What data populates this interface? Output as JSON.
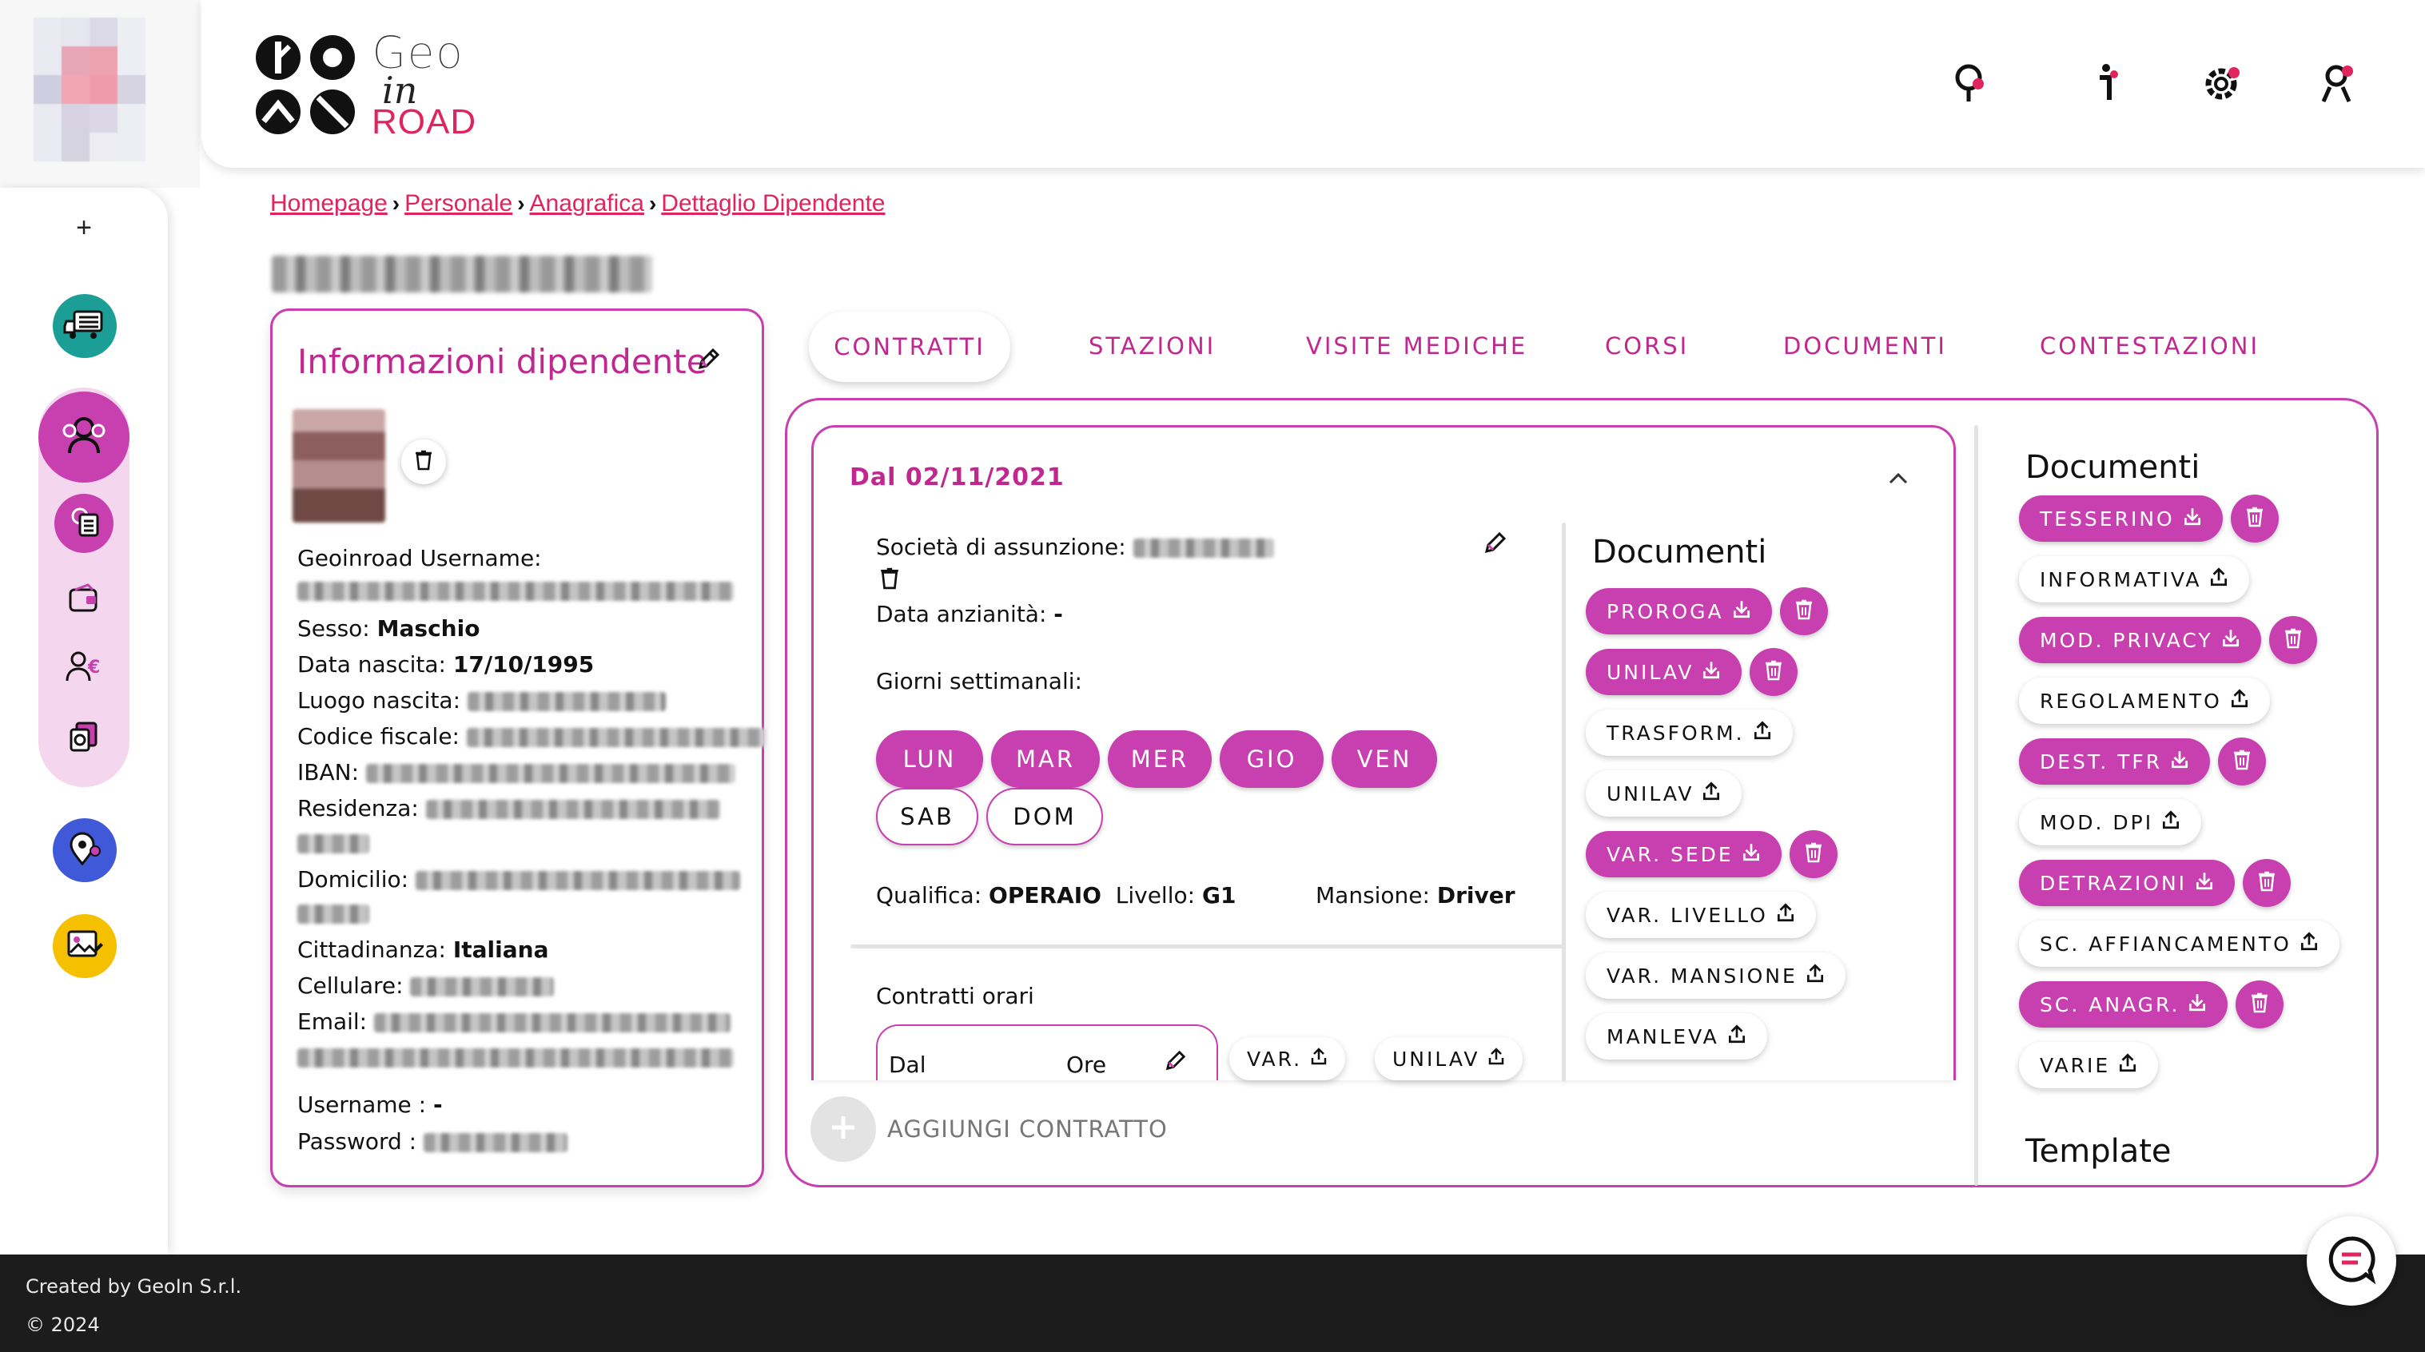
{
  "app": {
    "logo_line1": "Geo",
    "logo_line2": "in",
    "logo_line3": "ROAD",
    "accent": "#c83fb0",
    "brand_red": "#e0245e"
  },
  "header": {
    "icons": [
      "search-icon",
      "info-icon",
      "settings-icon",
      "user-icon"
    ]
  },
  "sidebar": {
    "add_label": "+",
    "icons": [
      "truck-icon",
      "users-icon",
      "user-document-icon",
      "wallet-icon",
      "user-euro-icon",
      "documents-icon",
      "map-pin-user-icon",
      "image-edit-icon"
    ]
  },
  "breadcrumb": {
    "items": [
      "Homepage",
      "Personale",
      "Anagrafica",
      "Dettaglio Dipendente"
    ]
  },
  "employee": {
    "card_title": "Informazioni dipendente",
    "username_label": "Geoinroad Username:",
    "sex_label": "Sesso:",
    "sex_value": "Maschio",
    "birth_label": "Data nascita:",
    "birth_value": "17/10/1995",
    "birthplace_label": "Luogo nascita:",
    "tax_code_label": "Codice fiscale:",
    "iban_label": "IBAN:",
    "residence_label": "Residenza:",
    "domicile_label": "Domicilio:",
    "citizenship_label": "Cittadinanza:",
    "citizenship_value": "Italiana",
    "phone_label": "Cellulare:",
    "email_label": "Email:",
    "user_label": "Username :",
    "user_value": "-",
    "password_label": "Password :"
  },
  "tabs": [
    "CONTRATTI",
    "STAZIONI",
    "VISITE MEDICHE",
    "CORSI",
    "DOCUMENTI",
    "CONTESTAZIONI"
  ],
  "contract": {
    "date_label": "Dal 02/11/2021",
    "company_label": "Società di assunzione:",
    "seniority_label": "Data anzianità:",
    "seniority_value": "-",
    "weekdays_label": "Giorni settimanali:",
    "days": [
      "LUN",
      "MAR",
      "MER",
      "GIO",
      "VEN",
      "SAB",
      "DOM"
    ],
    "days_active": [
      true,
      true,
      true,
      true,
      true,
      false,
      false
    ],
    "qualifica_label": "Qualifica:",
    "qualifica_value": "OPERAIO",
    "livello_label": "Livello:",
    "livello_value": "G1",
    "mansione_label": "Mansione:",
    "mansione_value": "Driver",
    "hours_label": "Contratti orari",
    "hours_from": "Dal",
    "hours_ore": "Ore",
    "hours_buttons": [
      "VAR.",
      "UNILAV"
    ],
    "docs_title": "Documenti",
    "docs": [
      {
        "label": "PROROGA",
        "uploaded": true
      },
      {
        "label": "UNILAV",
        "uploaded": true
      },
      {
        "label": "TRASFORM.",
        "uploaded": false
      },
      {
        "label": "UNILAV",
        "uploaded": false
      },
      {
        "label": "VAR. SEDE",
        "uploaded": true
      },
      {
        "label": "VAR. LIVELLO",
        "uploaded": false
      },
      {
        "label": "VAR. MANSIONE",
        "uploaded": false
      },
      {
        "label": "MANLEVA",
        "uploaded": false
      }
    ]
  },
  "add_contract_label": "AGGIUNGI CONTRATTO",
  "right_docs": {
    "title": "Documenti",
    "items": [
      {
        "label": "TESSERINO",
        "uploaded": true
      },
      {
        "label": "INFORMATIVA",
        "uploaded": false
      },
      {
        "label": "MOD. PRIVACY",
        "uploaded": true
      },
      {
        "label": "REGOLAMENTO",
        "uploaded": false
      },
      {
        "label": "DEST. TFR",
        "uploaded": true
      },
      {
        "label": "MOD. DPI",
        "uploaded": false
      },
      {
        "label": "DETRAZIONI",
        "uploaded": true
      },
      {
        "label": "SC. AFFIANCAMENTO",
        "uploaded": false
      },
      {
        "label": "SC. ANAGR.",
        "uploaded": true
      },
      {
        "label": "VARIE",
        "uploaded": false
      }
    ],
    "template_title": "Template"
  },
  "footer": {
    "line1": "Created by GeoIn S.r.l.",
    "line2": "© 2024"
  }
}
